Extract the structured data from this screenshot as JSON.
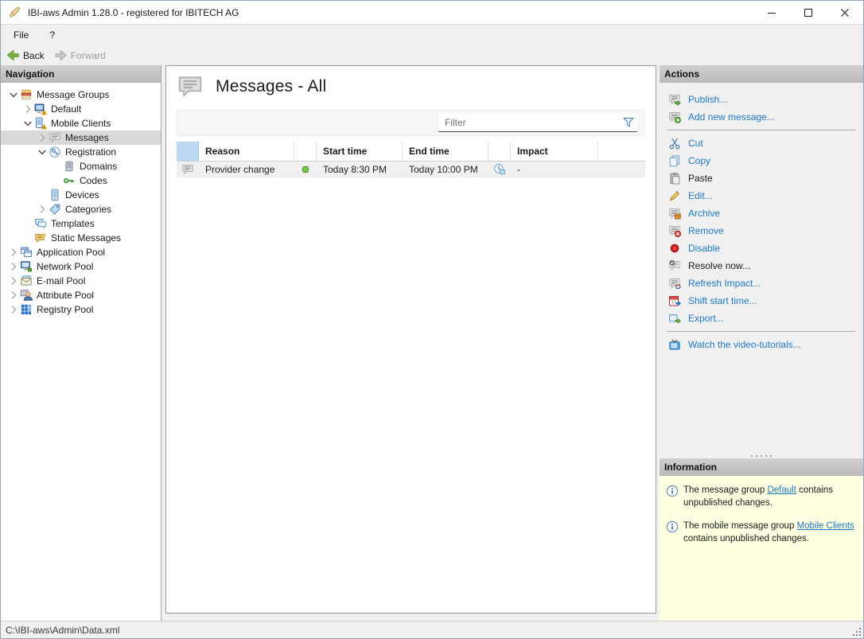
{
  "window": {
    "title": "IBI-aws Admin 1.28.0 - registered for IBITECH AG",
    "app_icon": "quill-icon"
  },
  "menu": {
    "items": [
      {
        "label": "File"
      },
      {
        "label": "?"
      }
    ]
  },
  "toolbar": {
    "back_label": "Back",
    "forward_label": "Forward"
  },
  "navigation": {
    "header": "Navigation",
    "tree": [
      {
        "label": "Message Groups",
        "level": 0,
        "state": "expanded",
        "icon": "message-groups",
        "selected": false
      },
      {
        "label": "Default",
        "level": 1,
        "state": "collapsed",
        "icon": "group-default",
        "selected": false
      },
      {
        "label": "Mobile Clients",
        "level": 1,
        "state": "expanded",
        "icon": "group-mobile",
        "selected": false
      },
      {
        "label": "Messages",
        "level": 2,
        "state": "collapsed",
        "icon": "messages",
        "selected": true
      },
      {
        "label": "Registration",
        "level": 2,
        "state": "expanded",
        "icon": "registration",
        "selected": false
      },
      {
        "label": "Domains",
        "level": 3,
        "state": "none",
        "icon": "domains",
        "selected": false
      },
      {
        "label": "Codes",
        "level": 3,
        "state": "none",
        "icon": "codes",
        "selected": false
      },
      {
        "label": "Devices",
        "level": 2,
        "state": "none",
        "icon": "devices",
        "selected": false
      },
      {
        "label": "Categories",
        "level": 2,
        "state": "collapsed",
        "icon": "categories",
        "selected": false
      },
      {
        "label": "Templates",
        "level": 1,
        "state": "none",
        "icon": "templates",
        "selected": false
      },
      {
        "label": "Static Messages",
        "level": 1,
        "state": "none",
        "icon": "static-messages",
        "selected": false
      },
      {
        "label": "Application Pool",
        "level": 0,
        "state": "collapsed",
        "icon": "application-pool",
        "selected": false
      },
      {
        "label": "Network Pool",
        "level": 0,
        "state": "collapsed",
        "icon": "network-pool",
        "selected": false
      },
      {
        "label": "E-mail Pool",
        "level": 0,
        "state": "collapsed",
        "icon": "email-pool",
        "selected": false
      },
      {
        "label": "Attribute Pool",
        "level": 0,
        "state": "collapsed",
        "icon": "attribute-pool",
        "selected": false
      },
      {
        "label": "Registry Pool",
        "level": 0,
        "state": "collapsed",
        "icon": "registry-pool",
        "selected": false
      }
    ]
  },
  "content": {
    "title": "Messages - All",
    "title_icon": "message-bubble",
    "filter_placeholder": "Filter",
    "filter_icon": "funnel-icon",
    "table": {
      "columns": [
        "",
        "Reason",
        "",
        "Start time",
        "End time",
        "",
        "Impact"
      ],
      "rows": [
        {
          "row_icon": "message-bubble",
          "reason": "Provider change",
          "status_icon": "green-dot",
          "start_time": "Today 8:30 PM",
          "end_time": "Today 10:00 PM",
          "impact_icon": "impact-clock",
          "impact": "-"
        }
      ]
    }
  },
  "actions": {
    "header": "Actions",
    "items": [
      {
        "label": "Publish...",
        "icon": "publish",
        "enabled": true,
        "separator_after": false
      },
      {
        "label": "Add new message...",
        "icon": "add-message",
        "enabled": true,
        "separator_after": true
      },
      {
        "label": "Cut",
        "icon": "cut",
        "enabled": true,
        "separator_after": false
      },
      {
        "label": "Copy",
        "icon": "copy",
        "enabled": true,
        "separator_after": false
      },
      {
        "label": "Paste",
        "icon": "paste",
        "enabled": false,
        "separator_after": false
      },
      {
        "label": "Edit...",
        "icon": "edit",
        "enabled": true,
        "separator_after": false
      },
      {
        "label": "Archive",
        "icon": "archive",
        "enabled": true,
        "separator_after": false
      },
      {
        "label": "Remove",
        "icon": "remove",
        "enabled": true,
        "separator_after": false
      },
      {
        "label": "Disable",
        "icon": "disable",
        "enabled": true,
        "separator_after": false
      },
      {
        "label": "Resolve now...",
        "icon": "resolve",
        "enabled": false,
        "separator_after": false
      },
      {
        "label": "Refresh Impact...",
        "icon": "refresh-impact",
        "enabled": true,
        "separator_after": false
      },
      {
        "label": "Shift start time...",
        "icon": "shift-start-time",
        "enabled": true,
        "separator_after": false
      },
      {
        "label": "Export...",
        "icon": "export",
        "enabled": true,
        "separator_after": true
      },
      {
        "label": "Watch the video-tutorials...",
        "icon": "video-tutorials",
        "enabled": true,
        "separator_after": false
      }
    ]
  },
  "information": {
    "header": "Information",
    "items": [
      {
        "icon": "info-icon",
        "parts": [
          {
            "text": "The message group "
          },
          {
            "link": "Default"
          },
          {
            "text": " contains unpublished changes."
          }
        ]
      },
      {
        "icon": "info-icon",
        "parts": [
          {
            "text": "The mobile message group "
          },
          {
            "link": "Mobile Clients"
          },
          {
            "text": " contains unpublished changes."
          }
        ]
      }
    ]
  },
  "statusbar": {
    "path": "C:\\IBI-aws\\Admin\\Data.xml"
  },
  "colors": {
    "link_blue": "#2079C3",
    "selection_gray": "#D9D9D9",
    "info_bg": "#FFFFE1",
    "table_icon_header": "#BCD8F0",
    "panel_header_top": "#D0D0D0",
    "panel_header_bottom": "#B9B9B9"
  }
}
